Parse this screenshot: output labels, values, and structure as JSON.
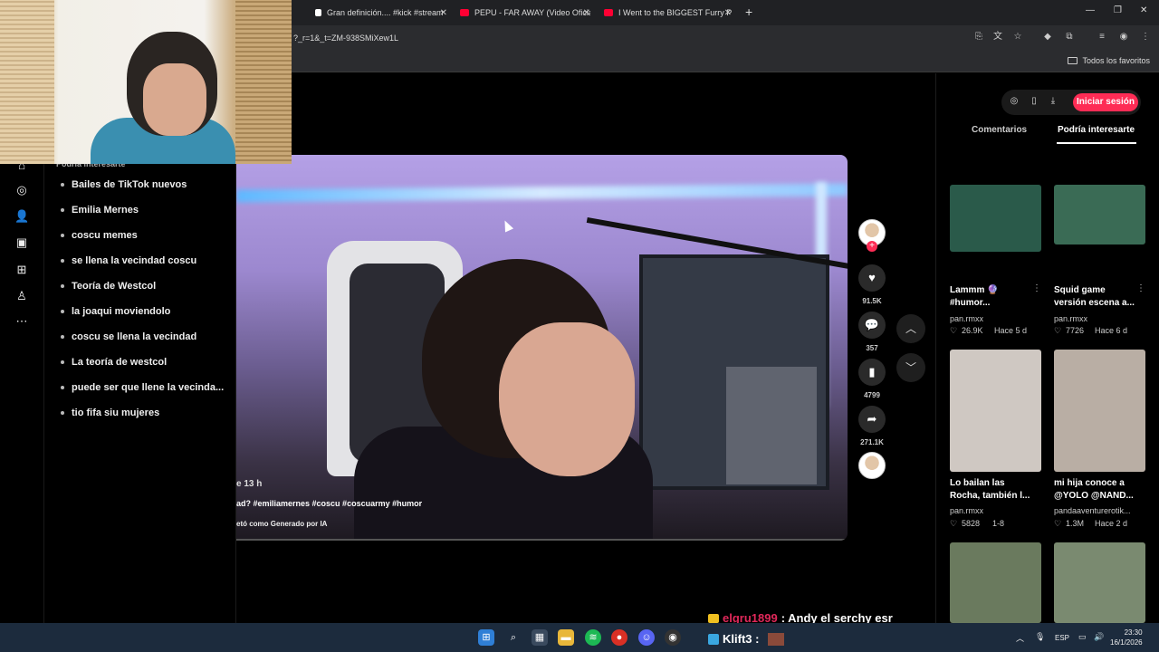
{
  "browser": {
    "tabs": [
      {
        "title": "Gran definición.... #kick #stream",
        "favicon_color": "#ffffff"
      },
      {
        "title": "PEPU - FAR AWAY (Video Oficial",
        "favicon_color": "#ff0033"
      },
      {
        "title": "I Went to the BIGGEST Furry Pa",
        "favicon_color": "#ff0033"
      }
    ],
    "url": "?_r=1&_t=ZM-938SMiXew1L",
    "bookmarks_folder": "Todos los favoritos"
  },
  "sidebar": {
    "title": "Podría interesarte",
    "icons": [
      "home-icon",
      "explore-icon",
      "following-icon",
      "live-icon",
      "upload-icon",
      "profile-icon",
      "more-icon"
    ],
    "suggestions": [
      "Bailes de TikTok nuevos",
      "Emilia Mernes",
      "coscu memes",
      "se llena la vecindad coscu",
      "Teoría de Westcol",
      "la joaqui moviendolo",
      "coscu se llena la vecindad",
      "La teoría de westcol",
      "puede ser que llene la vecinda...",
      "tio fifa siu mujeres"
    ]
  },
  "video": {
    "time_label": "e 13 h",
    "caption": "ad? #emiliamernes #coscu #coscuarmy #humor",
    "ai_label": "etó como Generado por IA"
  },
  "actions": {
    "likes": "91.5K",
    "comments": "357",
    "saves": "4799",
    "shares": "271.1K"
  },
  "right_panel": {
    "login_label": "Iniciar sesión",
    "tabs": [
      "Comentarios",
      "Podría interesarte"
    ],
    "cards": [
      {
        "title": "Lammm 🔮 #humor...",
        "user": "pan.rmxx",
        "likes": "26.9K",
        "date": "Hace 5 d",
        "thumb": "#2a5a4a"
      },
      {
        "title": "Squid game versión escena a...",
        "user": "pan.rmxx",
        "likes": "7726",
        "date": "Hace 6 d",
        "thumb": "#3a6b55"
      },
      {
        "title": "Lo bailan las Rocha, también l...",
        "user": "pan.rmxx",
        "likes": "5828",
        "date": "1-8",
        "thumb": "#cfc8c2"
      },
      {
        "title": "mi hija conoce a @YOLO @NAND...",
        "user": "pandaaventurerotik...",
        "likes": "1.3M",
        "date": "Hace 2 d",
        "thumb": "#b9aea4"
      },
      {
        "title": "",
        "user": "",
        "likes": "",
        "date": "",
        "thumb": "#6a7a5e"
      },
      {
        "title": "",
        "user": "",
        "likes": "",
        "date": "",
        "thumb": "#7a8a70"
      }
    ]
  },
  "stream_chat": {
    "user": "elgru1899",
    "message": ": Andy el serchy esr",
    "second_user": "Klift3 :"
  },
  "taskbar": {
    "lang": "ESP",
    "time": "23:30",
    "date": "16/1/2026"
  }
}
